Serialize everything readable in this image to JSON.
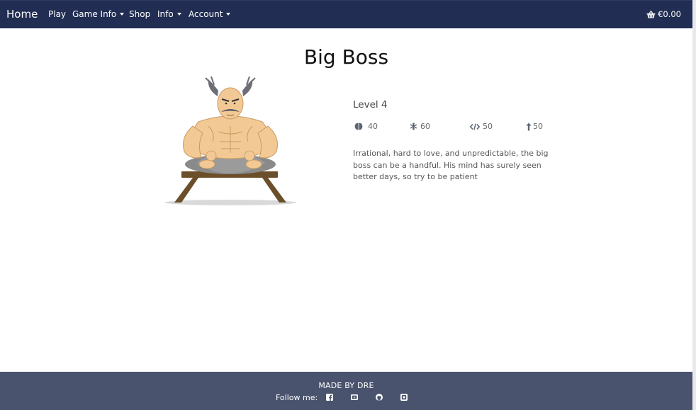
{
  "navbar": {
    "brand": "Home",
    "links": [
      {
        "label": "Play",
        "dropdown": false
      },
      {
        "label": "Game Info",
        "dropdown": true
      },
      {
        "label": "Shop",
        "dropdown": false
      },
      {
        "label": "Info",
        "dropdown": true
      },
      {
        "label": "Account",
        "dropdown": true
      }
    ],
    "cart": {
      "icon": "basket-icon",
      "total": "€0.00"
    }
  },
  "character": {
    "name": "Big Boss",
    "image": "big-boss-meditating-on-bench",
    "level": "Level 4",
    "stats": [
      {
        "icon": "brain-icon",
        "value": "40"
      },
      {
        "icon": "snowflake-icon",
        "value": "60"
      },
      {
        "icon": "code-icon",
        "value": "50"
      },
      {
        "icon": "arrow-up-icon",
        "value": "50"
      }
    ],
    "description": "Irrational, hard to love, and unpredictable, the big boss can be a handful. His mind has surely seen better days, so try to be patient"
  },
  "footer": {
    "made_by": "MADE BY DRE",
    "follow_label": "Follow me:",
    "social": [
      "facebook-icon",
      "youtube-icon",
      "github-icon",
      "instagram-icon"
    ]
  },
  "colors": {
    "navbar": "#212d52",
    "footer": "#4a536d",
    "bench": "#6b4f2a",
    "skin": "#f2c894"
  }
}
